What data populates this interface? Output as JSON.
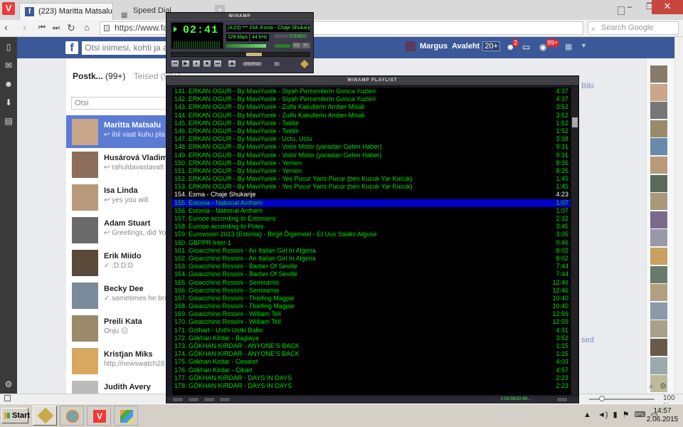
{
  "browser": {
    "tabs": [
      {
        "label": "(223) Maritta Matsalu - Me",
        "active": true
      },
      {
        "label": "Speed Dial",
        "active": false
      }
    ],
    "url": "https://www.face",
    "search_placeholder": "Search Google",
    "zoom": "100 %"
  },
  "facebook": {
    "search_placeholder": "Otsi inimesi, kohti ja asju",
    "user_name": "Margus",
    "home_label": "Avaleht",
    "home_count": "20+",
    "friend_badge": "2",
    "notif_badge": "99+",
    "messages": {
      "inbox_label": "Postk...",
      "inbox_count": "(99+)",
      "other_label": "Teised",
      "other_count": "(99+)",
      "search_placeholder": "Otsi",
      "threads": [
        {
          "name": "Maritta Matsalu",
          "snippet": "↩ ihii vaat kuhu pla",
          "selected": true
        },
        {
          "name": "Husárová Vladimír",
          "snippet": "↩ rahuldavastavalt"
        },
        {
          "name": "Isa Linda",
          "snippet": "↩ yes you will"
        },
        {
          "name": "Adam Stuart",
          "snippet": "↩ Greetings, did Yo"
        },
        {
          "name": "Erik Miido",
          "snippet": "✓ :D:D:D"
        },
        {
          "name": "Becky Dee",
          "snippet": "✓ sometimes he brin"
        },
        {
          "name": "Preili Kata",
          "snippet": "Onju ☹"
        },
        {
          "name": "Kristjan Miks",
          "snippet": "http://newswatch28.co"
        },
        {
          "name": "Judith Avery",
          "snippet": ""
        }
      ]
    },
    "right_text": {
      "top": "Biki",
      "bottom": "sed"
    }
  },
  "winamp": {
    "title": "WINAMP",
    "time": "02:41",
    "marquee": "(4:23) *** 154. Esma - Chaje Shukarije",
    "kbps": "128",
    "khz": "44",
    "mono_label": "MONO",
    "stereo_label": "STEREO",
    "eq_label": "EQ",
    "pl_label": "PL",
    "shuffle_label": "SHUFFLE",
    "seek_position": 0.61,
    "volume_level": 0.85
  },
  "playlist": {
    "title": "WINAMP PLAYLIST",
    "total_time": "1:02:05/10:49:..",
    "current_index": 13,
    "selected_index": 14,
    "tracks": [
      {
        "title": "141. ERKAN OGUR - By MaviYurek - Siyah Percemlerin Gonca Yuzleri",
        "duration": "4:37"
      },
      {
        "title": "142. ERKAN OGUR - By MaviYurek - Siyah Percemlerin Gonca Yuzleri",
        "duration": "4:37"
      },
      {
        "title": "143. ERKAN OGUR - By MaviYurek - Zulfu Kakullerin Amber Misali",
        "duration": "3:52"
      },
      {
        "title": "144. ERKAN OGUR - By MaviYurek - Zulfu Kakullerin Amber Misali",
        "duration": "3:52"
      },
      {
        "title": "145. ERKAN OGUR - By MaviYurek - Tekbir",
        "duration": "1:52"
      },
      {
        "title": "146. ERKAN OGUR - By MaviYurek - Tekbir",
        "duration": "1:52"
      },
      {
        "title": "147. ERKAN OGUR - By MaviYurek - Uctu, Uctu",
        "duration": "3:38"
      },
      {
        "title": "148. ERKAN OGUR - By MaviYurek - Volor Molor (yaradan Gelen Haber)",
        "duration": "9:31"
      },
      {
        "title": "149. ERKAN OGUR - By MaviYurek - Volor Molor (yaradan Gelen Haber)",
        "duration": "9:31"
      },
      {
        "title": "150. ERKAN OGUR - By MaviYurek - Yemen",
        "duration": "8:35"
      },
      {
        "title": "151. ERKAN OGUR - By MaviYurek - Yemen",
        "duration": "8:35"
      },
      {
        "title": "152. ERKAN OGUR - By MaviYurek - Yes Pucur Yaris Pucur (ben Kucuk Yar Kucuk)",
        "duration": "1:45"
      },
      {
        "title": "153. ERKAN OGUR - By MaviYurek - Yes Pucur Yaris Pucur (ben Kucuk Yar Kucuk)",
        "duration": "1:45"
      },
      {
        "title": "154. Esma - Chaje Shukarije",
        "duration": "4:23"
      },
      {
        "title": "155. Estonia - National Anthem",
        "duration": "1:07"
      },
      {
        "title": "156. Estonia - National Anthem",
        "duration": "1:07"
      },
      {
        "title": "157. Europe according to Estonians",
        "duration": "2:32"
      },
      {
        "title": "158. Europe according to Poles",
        "duration": "3:45"
      },
      {
        "title": "159. Eurovision 2013 (Estonia) - Birgit Õigemeel - Et Uus Saaks Alguse",
        "duration": "3:05"
      },
      {
        "title": "160. GBPPR Inter-1",
        "duration": "0:46"
      },
      {
        "title": "161. Gioacchino Rossini - An Italian Girl In Algeria",
        "duration": "8:02"
      },
      {
        "title": "162. Gioacchino Rossini - An Italian Girl In Algeria",
        "duration": "8:02"
      },
      {
        "title": "163. Gioacchino Rossini - Barber Of Seville",
        "duration": "7:44"
      },
      {
        "title": "164. Gioacchino Rossini - Barber Of Seville",
        "duration": "7:44"
      },
      {
        "title": "165. Gioacchino Rossini - Semiramis",
        "duration": "12:46"
      },
      {
        "title": "166. Gioacchino Rossini - Semiramis",
        "duration": "12:46"
      },
      {
        "title": "167. Gioacchino Rossini - Thiefing Magpie",
        "duration": "10:40"
      },
      {
        "title": "168. Gioacchino Rossini - Thiefing Magpie",
        "duration": "10:40"
      },
      {
        "title": "169. Gioacchino Rossini - William Tell",
        "duration": "12:59"
      },
      {
        "title": "170. Gioacchino Rossini - William Tell",
        "duration": "12:59"
      },
      {
        "title": "171. Gothart - Usthi Ustki Babo",
        "duration": "4:31"
      },
      {
        "title": "172. Gökhan Kirdar - Baglaya",
        "duration": "3:52"
      },
      {
        "title": "173. GÖKHAN KIRDAR - ANYONE'S BACK",
        "duration": "1:15"
      },
      {
        "title": "174. GÖKHAN KIRDAR - ANYONE'S BACK",
        "duration": "1:15"
      },
      {
        "title": "175. Gökhan Kirdar - Cesaret",
        "duration": "4:03"
      },
      {
        "title": "176. Gökhan Kirdar - Cikart",
        "duration": "4:57"
      },
      {
        "title": "177. GÖKHAN KIRDAR - DAYS IN DAYS",
        "duration": "2:23"
      },
      {
        "title": "178. GÖKHAN KIRDAR - DAYS IN DAYS",
        "duration": "2:23"
      }
    ]
  },
  "taskbar": {
    "start_label": "Start",
    "time": "14:57",
    "date": "2.06.2015"
  },
  "colors": {
    "fb_blue": "#3b5998",
    "winamp_green": "#00e000",
    "playlist_selection": "#0000c6",
    "vivaldi_red": "#ef3939"
  }
}
